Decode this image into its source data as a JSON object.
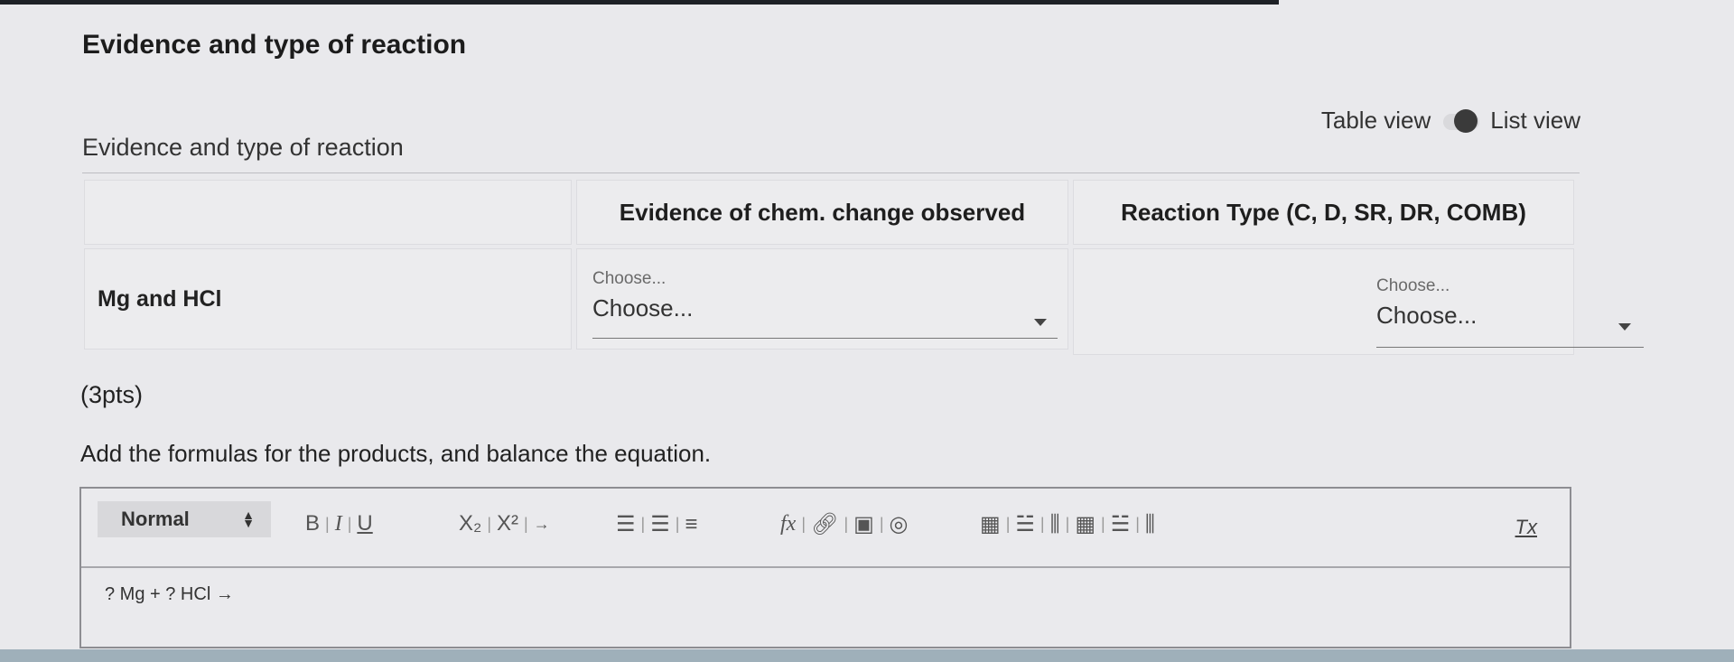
{
  "page": {
    "title": "Evidence and type of reaction"
  },
  "view_toggle": {
    "left_label": "Table view",
    "right_label": "List view",
    "state": "list"
  },
  "section": {
    "label": "Evidence and type of reaction"
  },
  "table": {
    "headers": [
      "",
      "Evidence of chem. change observed",
      "Reaction Type (C, D, SR, DR, COMB)"
    ],
    "rows": [
      {
        "label": "Mg and HCl",
        "evidence": {
          "placeholder": "Choose...",
          "value": "Choose..."
        },
        "reaction_type": {
          "placeholder": "Choose...",
          "value": "Choose..."
        }
      }
    ]
  },
  "points": "(3pts)",
  "instruction": "Add the formulas for the products, and balance the equation.",
  "editor": {
    "format": "Normal",
    "buttons": {
      "bold": "B",
      "italic": "I",
      "underline": "U",
      "subscript": "X₂",
      "superscript": "X²",
      "arrow": "→",
      "formula": "fx",
      "clear": "Tx"
    },
    "content": "? Mg + ? HCl →"
  },
  "colors": {
    "background": "#e9e9ec",
    "cell": "#ececee",
    "border": "#8d8d92"
  }
}
